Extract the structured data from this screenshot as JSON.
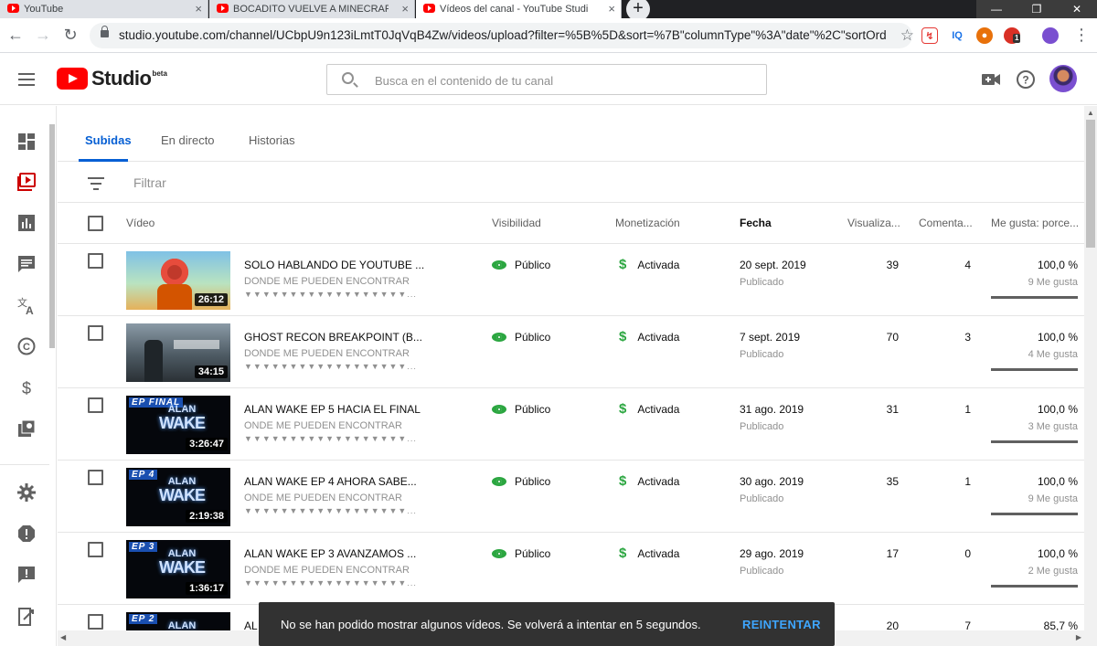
{
  "browser": {
    "tabs": [
      {
        "title": "YouTube",
        "active": false
      },
      {
        "title": "BOCADITO VUELVE A MINECRAF",
        "active": false
      },
      {
        "title": "Vídeos del canal - YouTube Studi",
        "active": true
      }
    ],
    "url": "studio.youtube.com/channel/UCbpU9n123iLmtT0JqVqB4Zw/videos/upload?filter=%5B%5D&sort=%7B\"columnType\"%3A\"date\"%2C\"sortOrd...",
    "ext_iq": "IQ",
    "ext_badge": "1"
  },
  "header": {
    "logo_text": "Studio",
    "logo_badge": "beta",
    "search_placeholder": "Busca en el contenido de tu canal"
  },
  "tabs": {
    "uploads": "Subidas",
    "live": "En directo",
    "stories": "Historias"
  },
  "filter_label": "Filtrar",
  "columns": {
    "video": "Vídeo",
    "visibility": "Visibilidad",
    "monetization": "Monetización",
    "date": "Fecha",
    "views": "Visualiza...",
    "comments": "Comenta...",
    "likes": "Me gusta: porce..."
  },
  "videos": [
    {
      "title": "SOLO HABLANDO DE YOUTUBE ...",
      "desc": "DONDE ME PUEDEN ENCONTRAR",
      "arrows": "▼▼▼▼▼▼▼▼▼▼▼▼▼▼▼▼▼▼...",
      "duration": "26:12",
      "thumb": "nms",
      "visibility": "Público",
      "monetization": "Activada",
      "date": "20 sept. 2019",
      "status": "Publicado",
      "views": "39",
      "comments": "4",
      "likes_pct": "100,0 %",
      "likes_count": "9 Me gusta"
    },
    {
      "title": "GHOST RECON BREAKPOINT (B...",
      "desc": "DONDE ME PUEDEN ENCONTRAR",
      "arrows": "▼▼▼▼▼▼▼▼▼▼▼▼▼▼▼▼▼▼...",
      "duration": "34:15",
      "thumb": "ghost",
      "visibility": "Público",
      "monetization": "Activada",
      "date": "7 sept. 2019",
      "status": "Publicado",
      "views": "70",
      "comments": "3",
      "likes_pct": "100,0 %",
      "likes_count": "4 Me gusta"
    },
    {
      "title": "ALAN WAKE EP 5 HACIA EL FINAL",
      "desc": "ONDE ME PUEDEN ENCONTRAR",
      "arrows": "▼▼▼▼▼▼▼▼▼▼▼▼▼▼▼▼▼▼...",
      "duration": "3:26:47",
      "thumb": "aw",
      "ep": "EP FINAL",
      "visibility": "Público",
      "monetization": "Activada",
      "date": "31 ago. 2019",
      "status": "Publicado",
      "views": "31",
      "comments": "1",
      "likes_pct": "100,0 %",
      "likes_count": "3 Me gusta"
    },
    {
      "title": "ALAN WAKE EP 4 AHORA SABE...",
      "desc": "ONDE ME PUEDEN ENCONTRAR",
      "arrows": "▼▼▼▼▼▼▼▼▼▼▼▼▼▼▼▼▼▼...",
      "duration": "2:19:38",
      "thumb": "aw",
      "ep": "EP 4",
      "visibility": "Público",
      "monetization": "Activada",
      "date": "30 ago. 2019",
      "status": "Publicado",
      "views": "35",
      "comments": "1",
      "likes_pct": "100,0 %",
      "likes_count": "9 Me gusta"
    },
    {
      "title": "ALAN WAKE EP 3 AVANZAMOS ...",
      "desc": "DONDE ME PUEDEN ENCONTRAR",
      "arrows": "▼▼▼▼▼▼▼▼▼▼▼▼▼▼▼▼▼▼...",
      "duration": "1:36:17",
      "thumb": "aw",
      "ep": "EP 3",
      "visibility": "Público",
      "monetization": "Activada",
      "date": "29 ago. 2019",
      "status": "Publicado",
      "views": "17",
      "comments": "0",
      "likes_pct": "100,0 %",
      "likes_count": "2 Me gusta"
    },
    {
      "title": "AL",
      "desc": "",
      "arrows": "",
      "duration": "",
      "thumb": "aw",
      "ep": "EP 2",
      "visibility": "",
      "monetization": "",
      "date": "",
      "status": "",
      "views": "20",
      "comments": "7",
      "likes_pct": "85,7 %",
      "likes_count": ""
    }
  ],
  "snackbar": {
    "message": "No se han podido mostrar algunos vídeos. Se volverá a intentar en 5 segundos.",
    "action": "REINTENTAR"
  },
  "colors": {
    "brand": "#ff0000",
    "accent": "#065fd4",
    "green": "#2ba640",
    "snack_action": "#3ea6ff"
  }
}
